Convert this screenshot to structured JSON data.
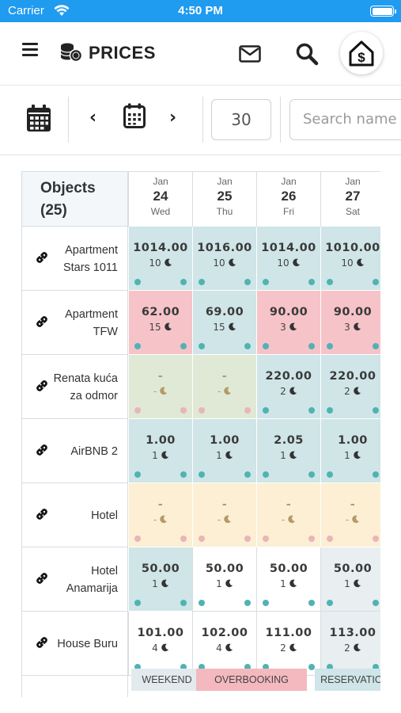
{
  "status_bar": {
    "carrier": "Carrier",
    "time": "4:50 PM"
  },
  "header": {
    "title": "PRICES"
  },
  "toolbar": {
    "days_value": "30",
    "search_placeholder": "Search name"
  },
  "grid": {
    "objects_header_line1": "Objects",
    "objects_header_line2": "(25)",
    "dates": [
      {
        "month": "Jan",
        "day": "24",
        "weekday": "Wed"
      },
      {
        "month": "Jan",
        "day": "25",
        "weekday": "Thu"
      },
      {
        "month": "Jan",
        "day": "26",
        "weekday": "Fri"
      },
      {
        "month": "Jan",
        "day": "27",
        "weekday": "Sat"
      }
    ],
    "rows": [
      {
        "name": "Apartment Stars 1011",
        "cells": [
          {
            "price": "1014.00",
            "nights": "10",
            "status": "reservation"
          },
          {
            "price": "1016.00",
            "nights": "10",
            "status": "reservation"
          },
          {
            "price": "1014.00",
            "nights": "10",
            "status": "reservation"
          },
          {
            "price": "1010.00",
            "nights": "10",
            "status": "reservation"
          }
        ]
      },
      {
        "name": "Apartment TFW",
        "cells": [
          {
            "price": "62.00",
            "nights": "15",
            "status": "overbooking"
          },
          {
            "price": "69.00",
            "nights": "15",
            "status": "reservation"
          },
          {
            "price": "90.00",
            "nights": "3",
            "status": "overbooking"
          },
          {
            "price": "90.00",
            "nights": "3",
            "status": "overbooking"
          }
        ]
      },
      {
        "name": "Renata kuća za odmor",
        "cells": [
          {
            "price": "-",
            "nights": "-",
            "status": "unavailable"
          },
          {
            "price": "-",
            "nights": "-",
            "status": "unavailable"
          },
          {
            "price": "220.00",
            "nights": "2",
            "status": "reservation"
          },
          {
            "price": "220.00",
            "nights": "2",
            "status": "reservation"
          }
        ]
      },
      {
        "name": "AirBNB 2",
        "cells": [
          {
            "price": "1.00",
            "nights": "1",
            "status": "reservation"
          },
          {
            "price": "1.00",
            "nights": "1",
            "status": "reservation"
          },
          {
            "price": "2.05",
            "nights": "1",
            "status": "reservation"
          },
          {
            "price": "1.00",
            "nights": "1",
            "status": "reservation"
          }
        ]
      },
      {
        "name": "Hotel",
        "cells": [
          {
            "price": "-",
            "nights": "-",
            "status": "closed"
          },
          {
            "price": "-",
            "nights": "-",
            "status": "closed"
          },
          {
            "price": "-",
            "nights": "-",
            "status": "closed"
          },
          {
            "price": "-",
            "nights": "-",
            "status": "closed"
          }
        ]
      },
      {
        "name": "Hotel Anamarija",
        "cells": [
          {
            "price": "50.00",
            "nights": "1",
            "status": "reservation"
          },
          {
            "price": "50.00",
            "nights": "1",
            "status": "free"
          },
          {
            "price": "50.00",
            "nights": "1",
            "status": "free"
          },
          {
            "price": "50.00",
            "nights": "1",
            "status": "weekend"
          }
        ]
      },
      {
        "name": "House Buru",
        "cells": [
          {
            "price": "101.00",
            "nights": "4",
            "status": "free"
          },
          {
            "price": "102.00",
            "nights": "4",
            "status": "free"
          },
          {
            "price": "111.00",
            "nights": "2",
            "status": "free"
          },
          {
            "price": "113.00",
            "nights": "2",
            "status": "weekend"
          }
        ]
      }
    ]
  },
  "legend": [
    {
      "label": "WEEKEND",
      "status": "weekend"
    },
    {
      "label": "OVERBOOKING",
      "status": "overbooking"
    },
    {
      "label": "RESERVATIONS",
      "status": "reservation"
    }
  ],
  "colors": {
    "status_bar": "#1f9bf0",
    "reservation": "#cfe5e7",
    "overbooking": "#f6c3c8",
    "unavailable": "#dfe9d6",
    "closed": "#fcefd4",
    "free": "#ffffff",
    "weekend": "#e9eef1",
    "dot_teal": "#4fb3b3",
    "dot_pink": "#eab4b8",
    "legend_weekend": "#e3eaed",
    "legend_overbooking": "#f4b8bf",
    "legend_reservation": "#cfe5e7"
  }
}
